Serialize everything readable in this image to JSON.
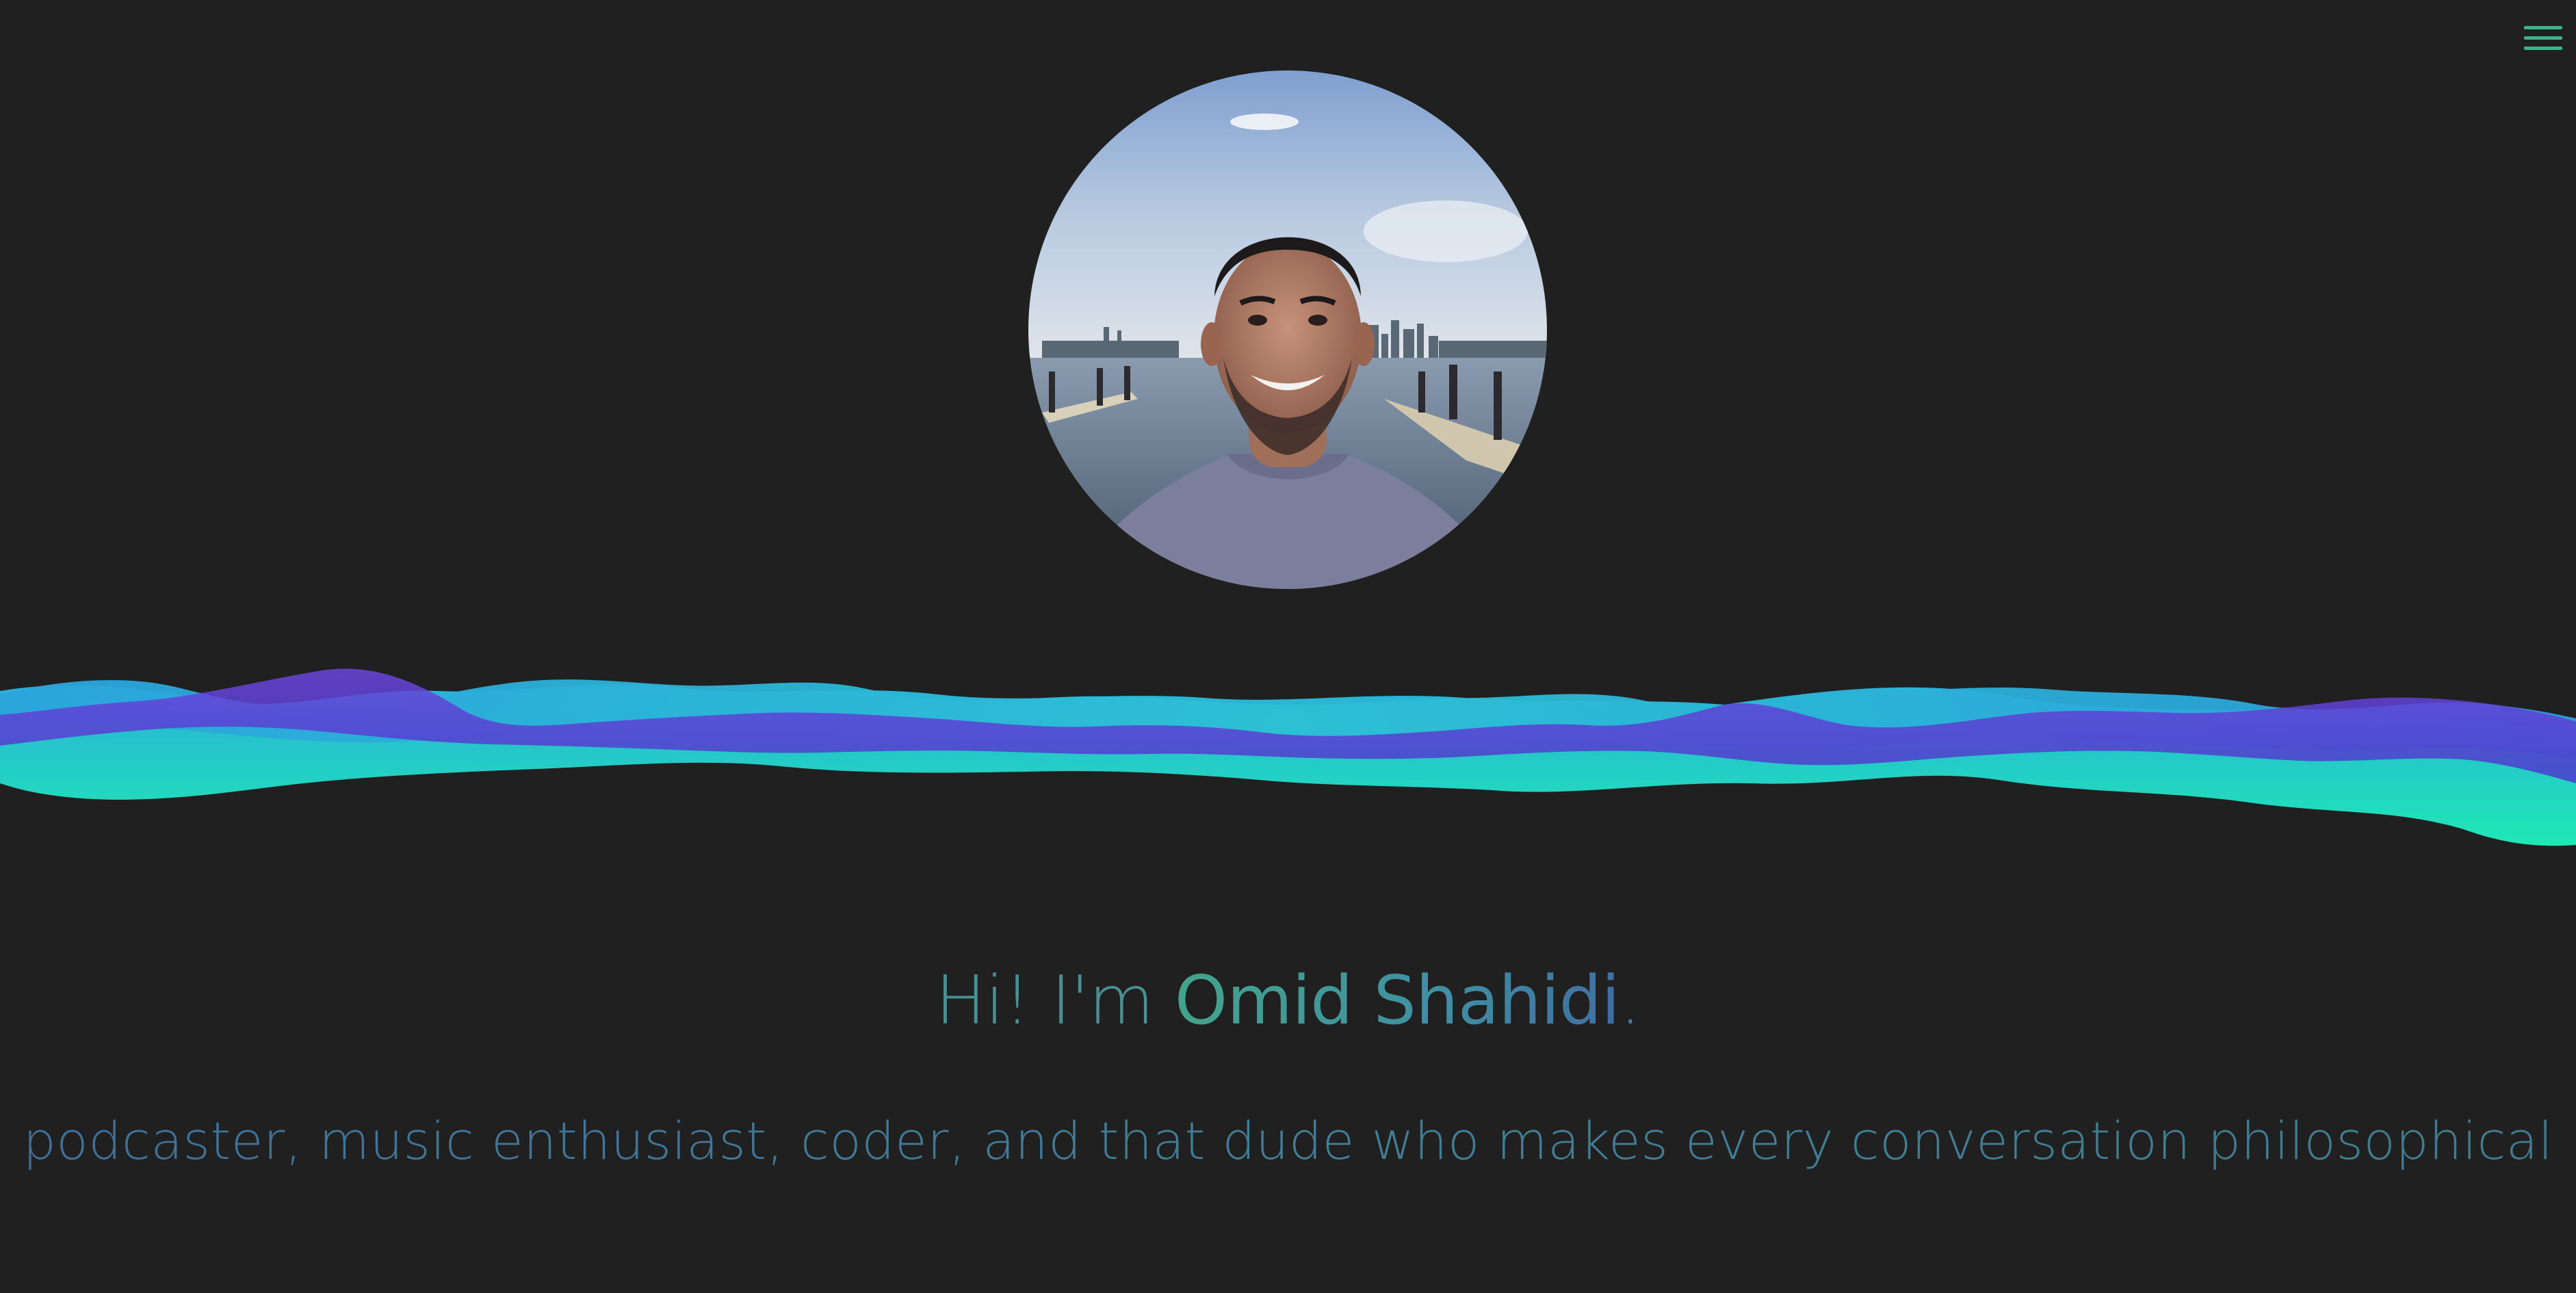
{
  "menu": {
    "icon": "hamburger-menu-icon",
    "color": "#3ab58a"
  },
  "profile": {
    "photo_description_icon": "profile-photo"
  },
  "hero": {
    "greeting_prefix": "Hi! I'm ",
    "name": "Omid Shahidi",
    "greeting_suffix": ".",
    "tagline": "podcaster, music enthusiast, coder, and that dude who makes every conversation philosophical"
  },
  "colors": {
    "background": "#212021",
    "wave_teal": "#1fe0b2",
    "wave_blue": "#2aa8d8",
    "wave_purple": "#5a3fd6",
    "text_gradient_start": "#43a38a",
    "text_gradient_end": "#3f6ea3"
  }
}
